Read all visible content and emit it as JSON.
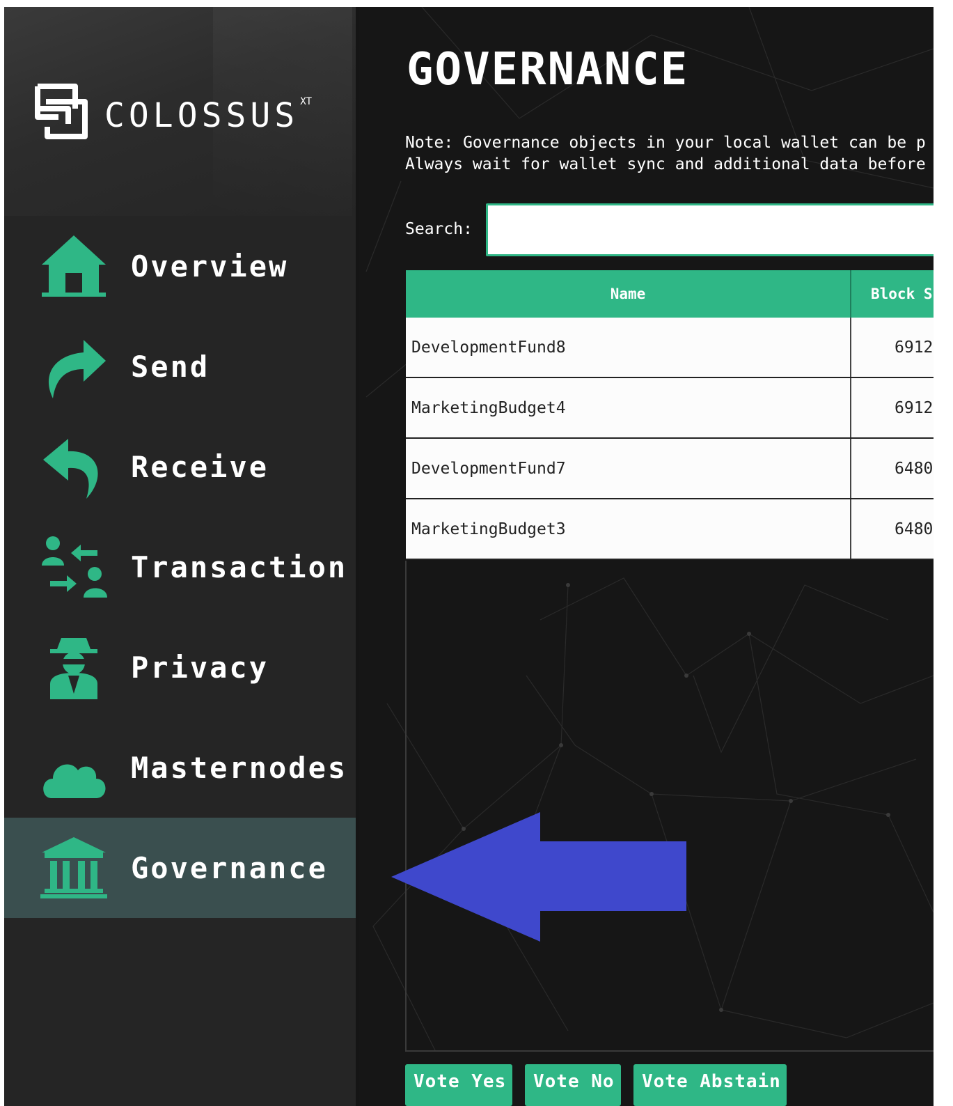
{
  "app": {
    "brand": "COLOSSUS",
    "brand_sup": "XT"
  },
  "sidebar": {
    "items": [
      {
        "label": "Overview",
        "icon": "home-icon"
      },
      {
        "label": "Send",
        "icon": "send-arrow-icon"
      },
      {
        "label": "Receive",
        "icon": "receive-arrow-icon"
      },
      {
        "label": "Transaction",
        "icon": "transaction-icon"
      },
      {
        "label": "Privacy",
        "icon": "spy-icon"
      },
      {
        "label": "Masternodes",
        "icon": "cloud-icon"
      },
      {
        "label": "Governance",
        "icon": "bank-icon",
        "active": true
      }
    ]
  },
  "main": {
    "title": "GOVERNANCE",
    "note_line1": "Note: Governance objects in your local wallet can be p",
    "note_line2": "Always wait for wallet sync and additional data before",
    "search_label": "Search:",
    "search_value": "",
    "table": {
      "columns": [
        "Name",
        "Block S"
      ],
      "rows": [
        {
          "name": "DevelopmentFund8",
          "block": "6912"
        },
        {
          "name": "MarketingBudget4",
          "block": "6912"
        },
        {
          "name": "DevelopmentFund7",
          "block": "6480"
        },
        {
          "name": "MarketingBudget3",
          "block": "6480"
        }
      ]
    },
    "buttons": {
      "vote_yes": "Vote Yes",
      "vote_no": "Vote No",
      "vote_abstain": "Vote Abstain"
    }
  },
  "colors": {
    "accent": "#2fb786",
    "sidebar_bg": "#252525",
    "active_bg": "#3a4f4f",
    "main_bg": "#161616",
    "annotation_arrow": "#3f48cc"
  }
}
